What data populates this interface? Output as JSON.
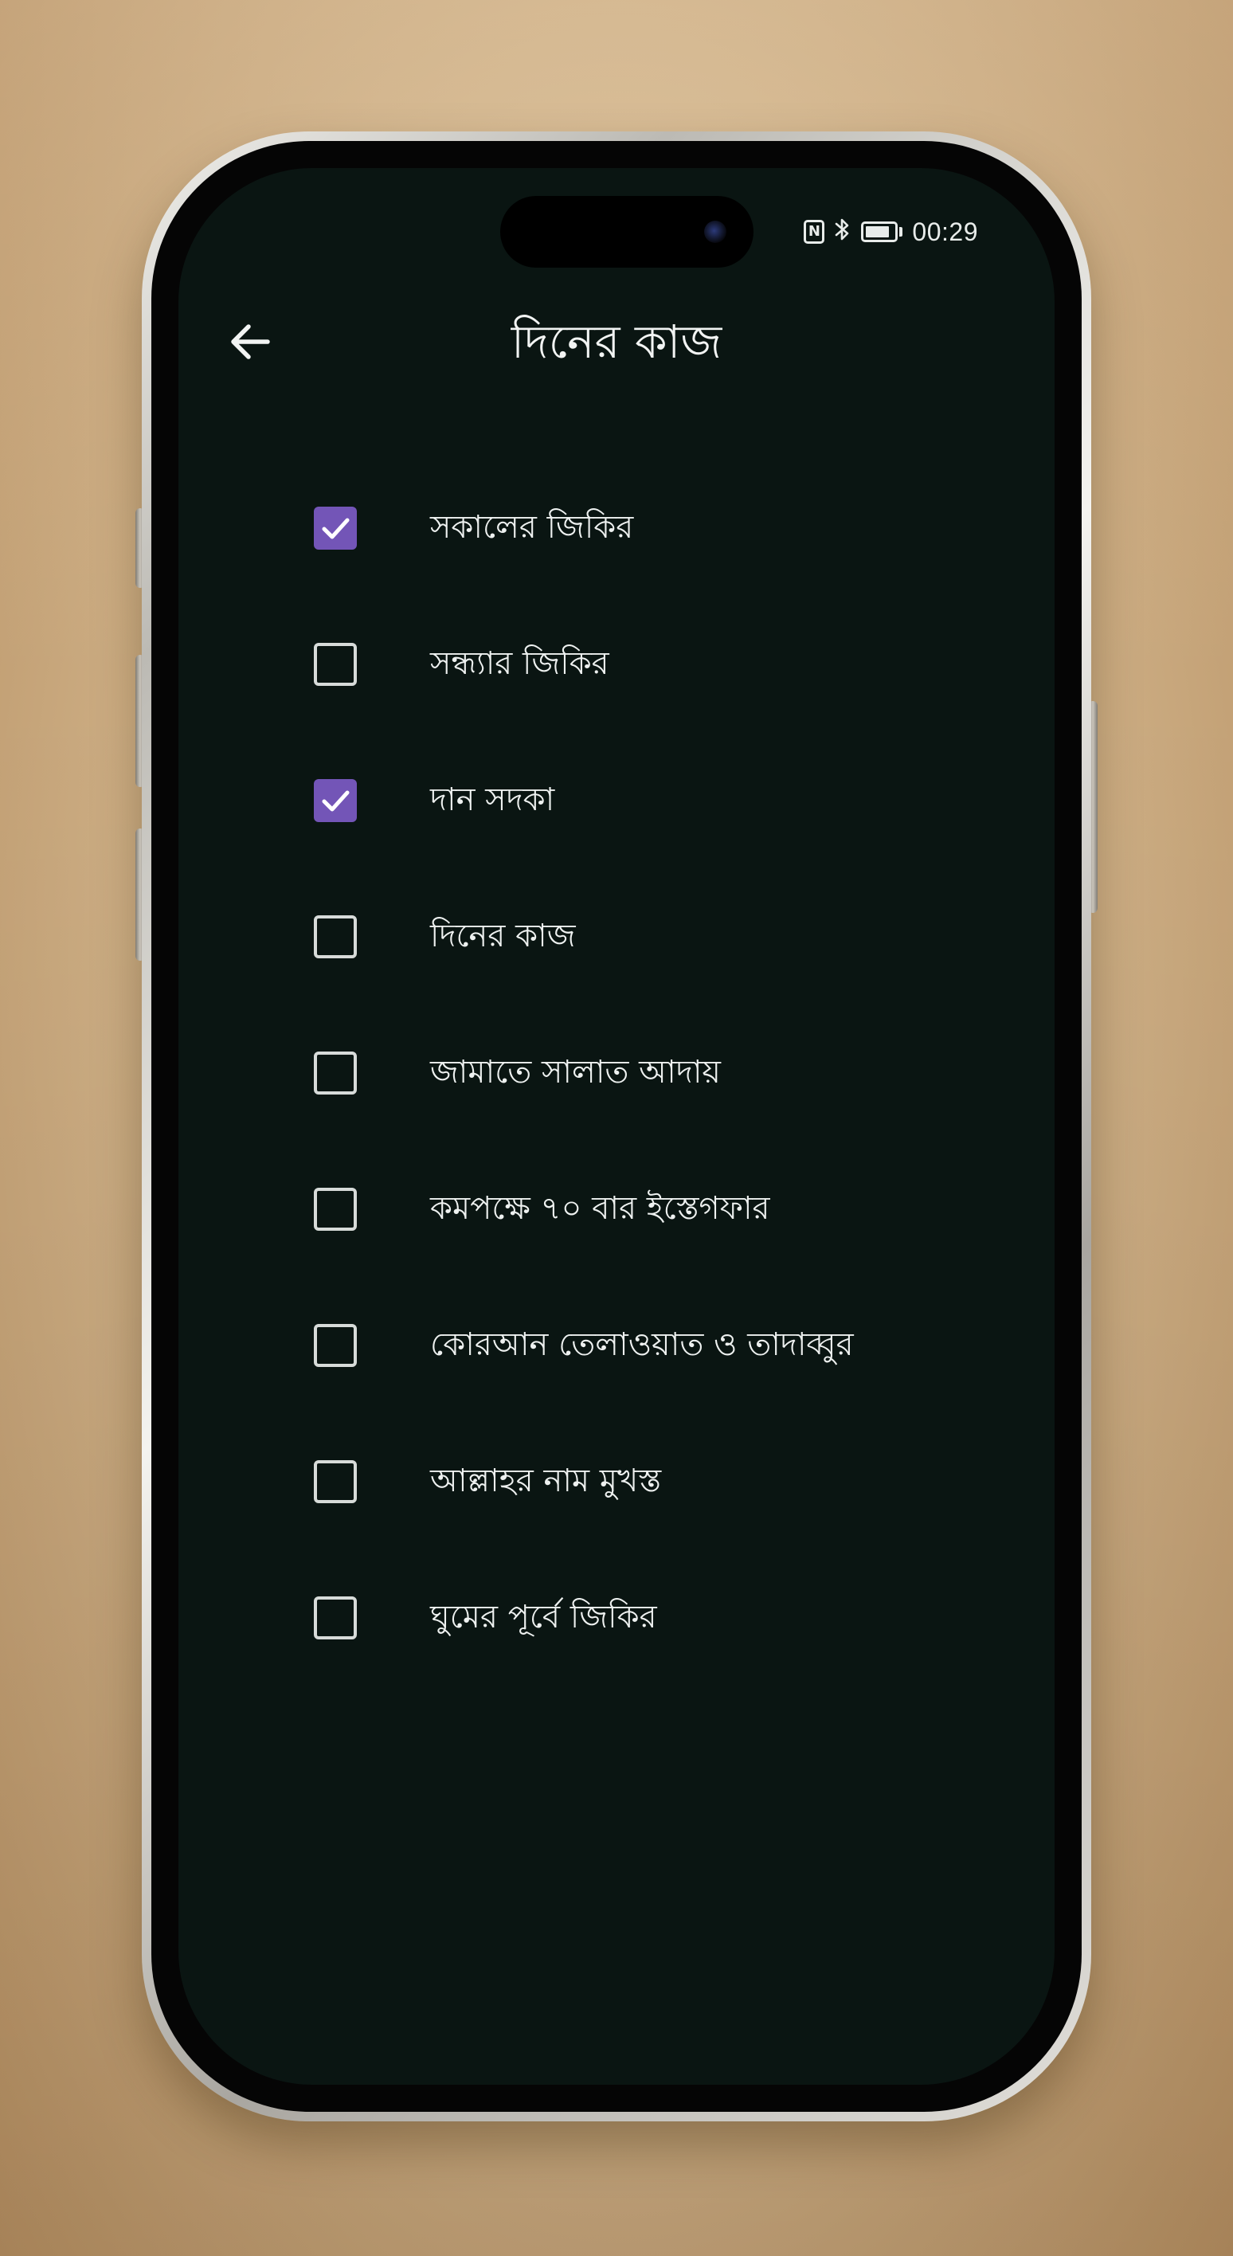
{
  "status_bar": {
    "nfc_icon": "nfc-icon",
    "nfc_glyph": "N",
    "bluetooth_icon": "bluetooth-icon",
    "battery_level": 0.85,
    "time": "00:29"
  },
  "app_bar": {
    "back_icon": "arrow-left-icon",
    "title": "দিনের কাজ"
  },
  "colors": {
    "background": "#0a1512",
    "checkbox_checked": "#7355b7",
    "text": "#eef1f0"
  },
  "tasks": [
    {
      "label": "সকালের জিকির",
      "checked": true
    },
    {
      "label": "সন্ধ্যার জিকির",
      "checked": false
    },
    {
      "label": "দান সদকা",
      "checked": true
    },
    {
      "label": "দিনের কাজ",
      "checked": false
    },
    {
      "label": "জামাতে সালাত আদায়",
      "checked": false
    },
    {
      "label": "কমপক্ষে ৭০ বার ইস্তেগফার",
      "checked": false
    },
    {
      "label": "কোরআন তেলাওয়াত ও তাদাব্বুর",
      "checked": false
    },
    {
      "label": "আল্লাহর নাম মুখস্ত",
      "checked": false
    },
    {
      "label": "ঘুমের পূর্বে জিকির",
      "checked": false
    }
  ]
}
